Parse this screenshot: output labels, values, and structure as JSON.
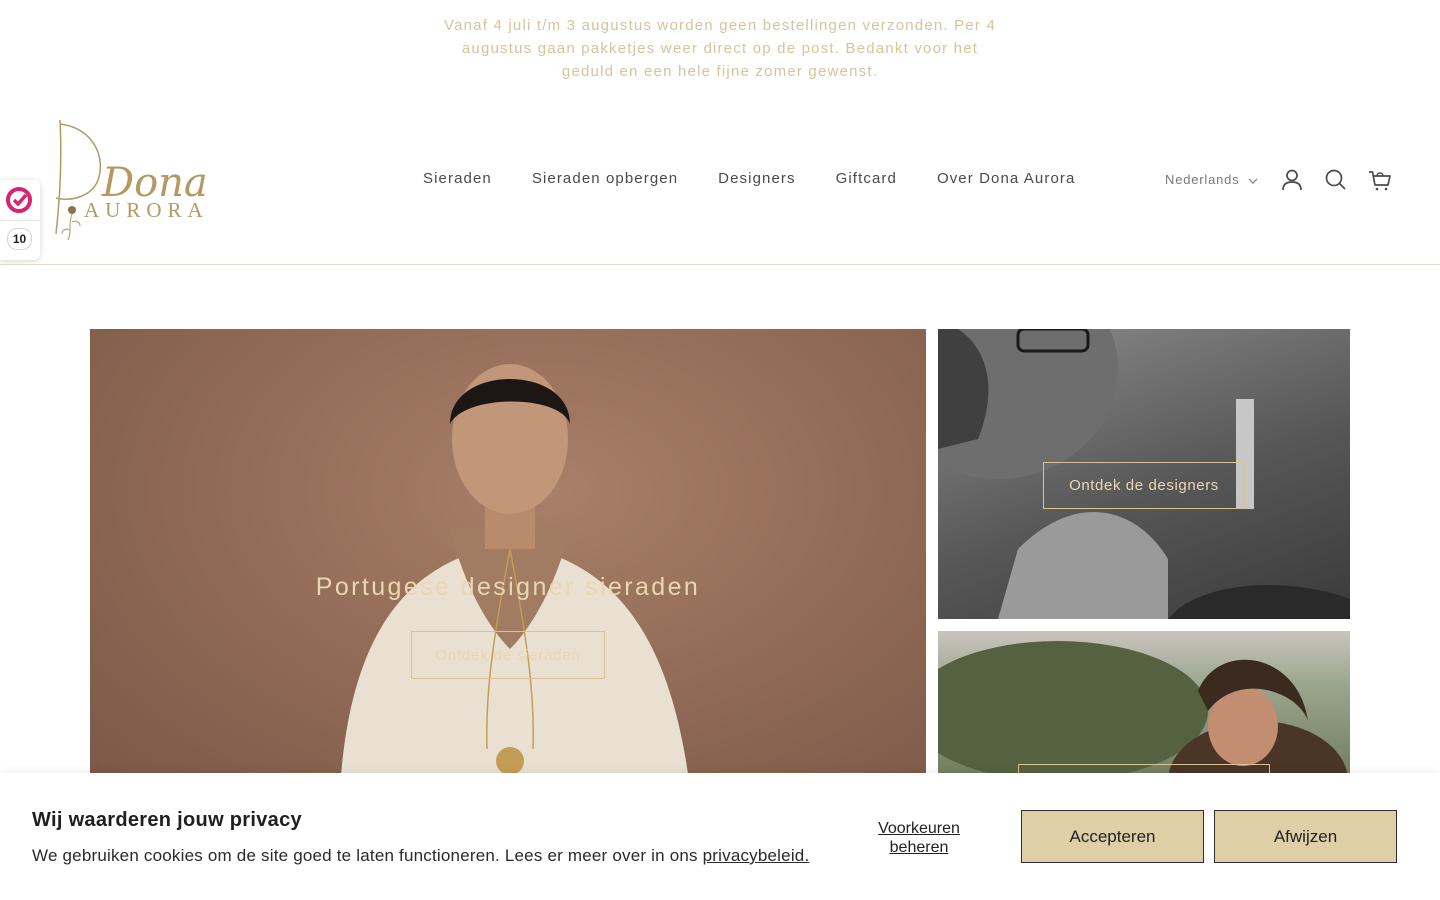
{
  "announcement": {
    "text": "Vanaf 4 juli t/m 3 augustus worden geen bestellingen verzonden. Per 4 augustus gaan pakketjes weer direct op de post. Bedankt voor het geduld en een hele fijne zomer gewenst."
  },
  "header": {
    "logo": {
      "script_text": "Dona",
      "caps_text": "AURORA"
    },
    "nav": [
      {
        "label": "Sieraden"
      },
      {
        "label": "Sieraden opbergen"
      },
      {
        "label": "Designers"
      },
      {
        "label": "Giftcard"
      },
      {
        "label": "Over Dona Aurora"
      }
    ],
    "language": "Nederlands",
    "icons": [
      "account-icon",
      "search-icon",
      "cart-icon"
    ]
  },
  "review_badge": {
    "score": "10"
  },
  "hero": {
    "title": "Portugese designer sieraden",
    "button": "Ontdek de sieraden"
  },
  "tiles": [
    {
      "button": "Ontdek de designers"
    },
    {
      "button": ""
    }
  ],
  "cookie": {
    "title": "Wij waarderen jouw privacy",
    "text": "We gebruiken cookies om de site goed te laten functioneren. Lees er meer over in ons ",
    "link": "privacybeleid.",
    "preferences": "Voorkeuren beheren",
    "accept": "Accepteren",
    "reject": "Afwijzen"
  },
  "colors": {
    "accent_gold": "#d8c39a",
    "button_fill": "#dfcfa7",
    "logo_gold": "#b49a62",
    "badge_pink": "#d6246e"
  }
}
